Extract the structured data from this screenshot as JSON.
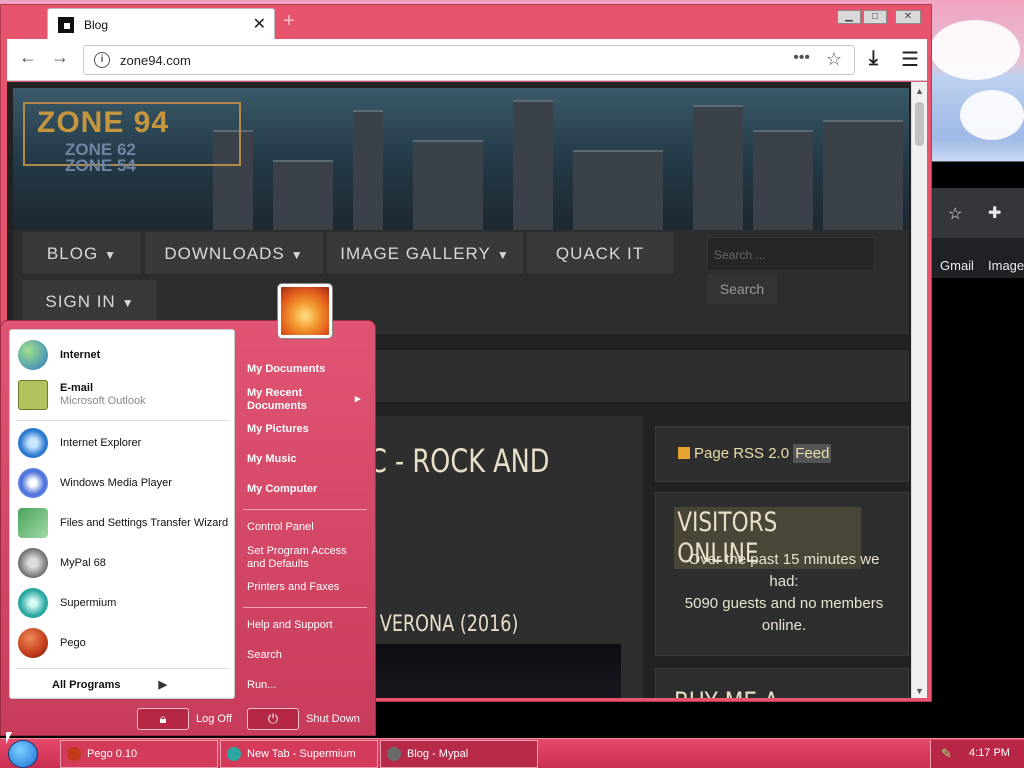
{
  "browser": {
    "tab_title": "Blog",
    "new_tab_glyph": "+",
    "url": "zone94.com",
    "page_actions_glyph": "•••",
    "minimize_glyph": "▁",
    "maximize_glyph": "□",
    "close_glyph": "✕",
    "icons": [
      "back-arrow-icon",
      "forward-arrow-icon",
      "info-icon",
      "bookmark-star-icon",
      "download-icon",
      "hamburger-menu-icon"
    ]
  },
  "site": {
    "logo": {
      "line1": "ZONE 94",
      "line2": "ZONE 62",
      "line3": "ZONE 54"
    },
    "nav": [
      {
        "label": "BLOG",
        "caret": "▼"
      },
      {
        "label": "DOWNLOADS",
        "caret": "▼"
      },
      {
        "label": "IMAGE GALLERY",
        "caret": "▼"
      },
      {
        "label": "QUACK IT",
        "caret": ""
      },
      {
        "label": "SIGN IN",
        "caret": "▼"
      }
    ],
    "search_placeholder": "Search ...",
    "search_button": "Search",
    "post_title": "C - ROCK AND",
    "post_subtitle": "I VERONA (2016)",
    "rss_text": "Page RSS 2.0",
    "rss_feed": "Feed",
    "visitors_heading": "VISITORS ONLINE",
    "visitors_line1": "Over the past 15 minutes we had:",
    "visitors_line2": "5090 guests and no members online.",
    "coffee_heading": "BUY ME A COFFEE"
  },
  "background_window": {
    "links": [
      "Gmail",
      "Image"
    ]
  },
  "start_menu": {
    "pinned": [
      {
        "label": "Internet",
        "icon": "globe-icon",
        "color": "#3b8fd6"
      },
      {
        "label": "E-mail",
        "sub": "Microsoft Outlook",
        "icon": "mail-icon",
        "color": "#8aa33d"
      }
    ],
    "recent": [
      {
        "label": "Internet Explorer",
        "icon": "internet-explorer-icon",
        "color": "#2b78d0"
      },
      {
        "label": "Windows Media Player",
        "icon": "media-player-icon",
        "color": "#4a6fd8"
      },
      {
        "label": "Files and Settings Transfer Wizard",
        "icon": "transfer-wizard-icon",
        "color": "#4ca35c"
      },
      {
        "label": "MyPal 68",
        "icon": "mypal-icon",
        "color": "#6b6b6b"
      },
      {
        "label": "Supermium",
        "icon": "supermium-icon",
        "color": "#2aa7a0"
      },
      {
        "label": "Pego",
        "icon": "pego-icon",
        "color": "#c23a1a"
      }
    ],
    "all_programs": "All Programs",
    "all_programs_arrow": "▶",
    "right_items": [
      {
        "label": "My Documents"
      },
      {
        "label": "My Recent Documents"
      },
      {
        "label": "My Pictures"
      },
      {
        "label": "My Music"
      },
      {
        "label": "My Computer"
      },
      {
        "label": "Control Panel"
      },
      {
        "label": "Set Program Access and Defaults"
      },
      {
        "label": "Printers and Faxes"
      },
      {
        "label": "Help and Support"
      },
      {
        "label": "Search"
      },
      {
        "label": "Run..."
      }
    ],
    "submenu_arrow": "▸",
    "log_off": "Log Off",
    "shut_down": "Shut Down"
  },
  "taskbar": {
    "tasks": [
      {
        "label": "Pego 0.10",
        "color": "#c23a1a"
      },
      {
        "label": "New Tab - Supermium",
        "color": "#2aa7a0"
      },
      {
        "label": "Blog - Mypal",
        "color": "#6b6b6b"
      }
    ],
    "clock": "4:17 PM"
  }
}
